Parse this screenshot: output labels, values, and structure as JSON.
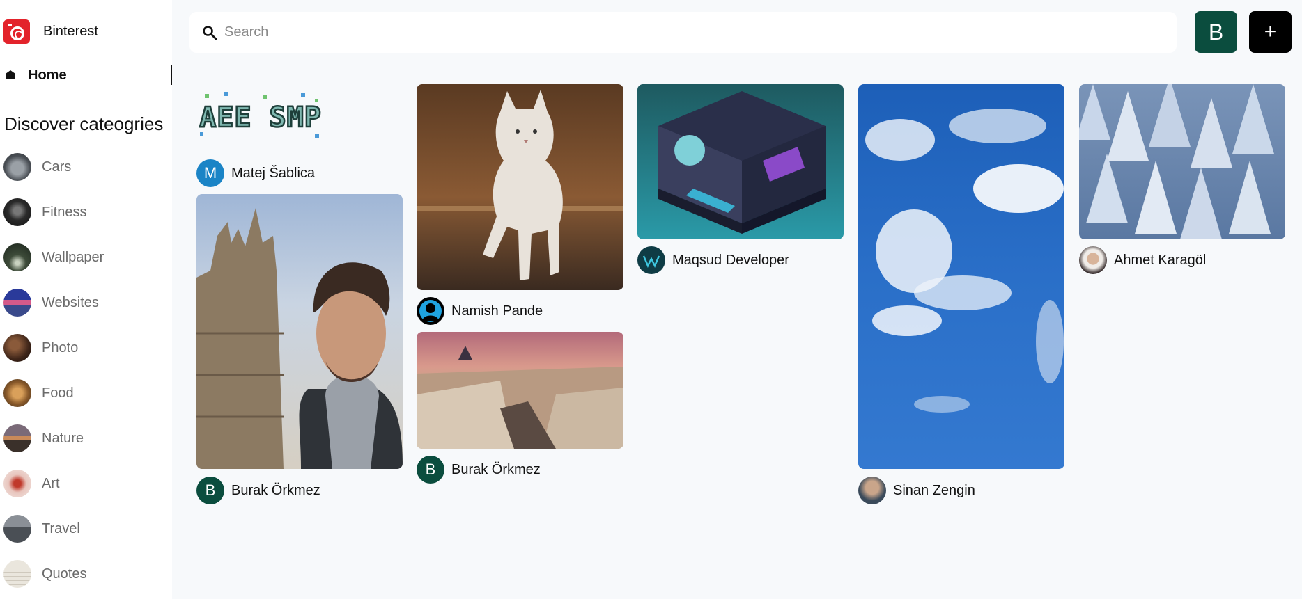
{
  "app": {
    "name": "Binterest"
  },
  "nav": {
    "home_label": "Home"
  },
  "sidebar": {
    "discover_title": "Discover cateogries",
    "categories": [
      {
        "label": "Cars",
        "thumb_color": "#5a5f66"
      },
      {
        "label": "Fitness",
        "thumb_color": "#2b2b2b"
      },
      {
        "label": "Wallpaper",
        "thumb_color": "#2f3a2d"
      },
      {
        "label": "Websites",
        "thumb_color": "#3a4a8c"
      },
      {
        "label": "Photo",
        "thumb_color": "#4a2e20"
      },
      {
        "label": "Food",
        "thumb_color": "#8a5a2a"
      },
      {
        "label": "Nature",
        "thumb_color": "#6b5550"
      },
      {
        "label": "Art",
        "thumb_color": "#d9b8b0"
      },
      {
        "label": "Travel",
        "thumb_color": "#6a6a6a"
      },
      {
        "label": "Quotes",
        "thumb_color": "#e6e3da"
      }
    ]
  },
  "search": {
    "placeholder": "Search",
    "value": ""
  },
  "header": {
    "user_initial": "B",
    "create_label": "+"
  },
  "pins": [
    {
      "author": "Matej Šablica",
      "avatar_letter": "M",
      "avatar_color": "#1b84c6",
      "image": "minecraft-server-logo",
      "image_text": "AEE SMP"
    },
    {
      "author": "Burak Örkmez",
      "avatar_letter": "B",
      "avatar_color": "#0b4d3e",
      "image": "selfie-photo"
    },
    {
      "author": "Namish Pande",
      "avatar_letter": "",
      "avatar_color": "#000000",
      "image": "white-cat-photo"
    },
    {
      "author": "Burak Örkmez",
      "avatar_letter": "B",
      "avatar_color": "#0b4d3e",
      "image": "city-aerial-photo"
    },
    {
      "author": "Maqsud Developer",
      "avatar_letter": "",
      "avatar_color": "#0f3c45",
      "image": "isometric-room-art"
    },
    {
      "author": "Sinan Zengin",
      "avatar_letter": "",
      "avatar_color": "#3a4a5a",
      "image": "blue-sky-photo"
    },
    {
      "author": "Ahmet Karagöl",
      "avatar_letter": "",
      "avatar_color": "#3a3030",
      "image": "snowy-forest-photo"
    }
  ]
}
